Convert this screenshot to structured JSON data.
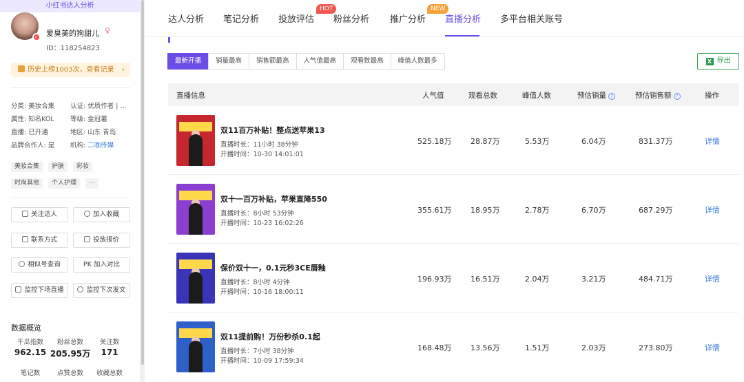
{
  "sidebar": {
    "header": "小红书达人分析",
    "nickname": "爱臭美的狗甜儿",
    "gender_icon": "female-icon",
    "uid": "ID：118254823",
    "history": "历史上榜1003次，查看记录",
    "info": {
      "category": "分类: 美妆合集",
      "auth": "认证: 优质作者 | ...",
      "attr": "属性: 知名KOL",
      "level": "等级: 金冠薯",
      "live": "直播: 已开通",
      "region": "地区: 山东 青岛",
      "brand": "品牌合作人: 是",
      "org_label": "机构: ",
      "org_link": "二咖传媒"
    },
    "tags": [
      "美妆合集",
      "护肤",
      "彩妆",
      "时尚其他",
      "个人护理",
      "···"
    ],
    "buttons": [
      "关注达人",
      "加入收藏",
      "联系方式",
      "投放报价",
      "相似号查询",
      "PK 加入对比",
      "监控下场直播",
      "监控下次发文"
    ],
    "overview": {
      "title": "数据概览",
      "stats": [
        {
          "label": "千瓜指数",
          "value": "962.15"
        },
        {
          "label": "粉丝总数",
          "value": "205.95万"
        },
        {
          "label": "关注数",
          "value": "171"
        }
      ],
      "stats2_labels": [
        "笔记数",
        "点赞总数",
        "收藏总数"
      ]
    }
  },
  "tabs": [
    {
      "label": "达人分析"
    },
    {
      "label": "笔记分析"
    },
    {
      "label": "投放评估",
      "badge": "HOT"
    },
    {
      "label": "粉丝分析"
    },
    {
      "label": "推广分析",
      "badge": "NEW"
    },
    {
      "label": "直播分析",
      "active": true
    },
    {
      "label": "多平台相关账号"
    }
  ],
  "filters": [
    "最新开播",
    "销量最高",
    "销售额最高",
    "人气值最高",
    "观看数最高",
    "峰值人数最多"
  ],
  "export_label": "导出",
  "table": {
    "headers": [
      "直播信息",
      "人气值",
      "观看总数",
      "峰值人数",
      "预估销量",
      "预估销售额",
      "操作"
    ],
    "rows": [
      {
        "title": "双11百万补贴！整点送苹果13",
        "duration": "直播时长：11小时 38分钟",
        "start": "开播时间：10-30 14:01:01",
        "popularity": "525.18万",
        "views": "28.87万",
        "peak": "5.53万",
        "sales": "6.04万",
        "revenue": "831.37万",
        "op": "详情"
      },
      {
        "title": "双十一百万补贴，苹果直降550",
        "duration": "直播时长：8小时 53分钟",
        "start": "开播时间：10-23 16:02:26",
        "popularity": "355.61万",
        "views": "18.95万",
        "peak": "2.78万",
        "sales": "6.70万",
        "revenue": "687.29万",
        "op": "详情"
      },
      {
        "title": "保价双十一，0.1元秒3CE唇釉",
        "duration": "直播时长：8小时 4分钟",
        "start": "开播时间：10-16 18:00:11",
        "popularity": "196.93万",
        "views": "16.51万",
        "peak": "2.04万",
        "sales": "3.21万",
        "revenue": "484.71万",
        "op": "详情"
      },
      {
        "title": "双11提前购！万份秒杀0.1起",
        "duration": "直播时长：7小时 38分钟",
        "start": "开播时间：10-09 17:59:34",
        "popularity": "168.48万",
        "views": "13.56万",
        "peak": "1.51万",
        "sales": "2.03万",
        "revenue": "273.80万",
        "op": "详情"
      }
    ]
  },
  "colors": {
    "accent": "#6a4de6",
    "link": "#3b7bd8",
    "export": "#2f9a4f"
  }
}
